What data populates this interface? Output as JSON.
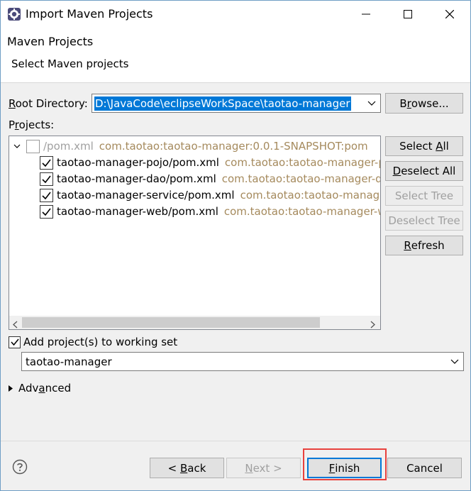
{
  "window": {
    "title": "Import Maven Projects",
    "minimize_icon": "minimize-icon",
    "maximize_icon": "maximize-icon",
    "close_icon": "close-icon"
  },
  "header": {
    "title": "Maven Projects",
    "subtitle": "Select Maven projects"
  },
  "root_directory": {
    "label_pre": "R",
    "label_rest": "oot Directory:",
    "value": "D:\\JavaCode\\eclipseWorkSpace\\taotao-manager",
    "browse_label_pre": "B",
    "browse_label_underline": "r",
    "browse_label_post": "owse..."
  },
  "projects": {
    "label_pre": "P",
    "label_underline": "r",
    "label_post": "ojects:",
    "tree": [
      {
        "name": "/pom.xml",
        "id": "com.taotao:taotao-manager:0.0.1-SNAPSHOT:pom",
        "checked": false,
        "level": 0
      },
      {
        "name": "taotao-manager-pojo/pom.xml",
        "id": "com.taotao:taotao-manager-p",
        "checked": true,
        "level": 1
      },
      {
        "name": "taotao-manager-dao/pom.xml",
        "id": "com.taotao:taotao-manager-da",
        "checked": true,
        "level": 1
      },
      {
        "name": "taotao-manager-service/pom.xml",
        "id": "com.taotao:taotao-manager",
        "checked": true,
        "level": 1
      },
      {
        "name": "taotao-manager-web/pom.xml",
        "id": "com.taotao:taotao-manager-w",
        "checked": true,
        "level": 1
      }
    ]
  },
  "side_buttons": {
    "select_all_pre": "Select ",
    "select_all_u": "A",
    "select_all_post": "ll",
    "deselect_all_u": "D",
    "deselect_all_post": "eselect All",
    "select_tree": "Select Tree",
    "deselect_tree": "Deselect Tree",
    "refresh_u": "R",
    "refresh_post": "efresh"
  },
  "working_set": {
    "checkbox_label": "Add project(s) to working set",
    "checked": true,
    "value": "taotao-manager"
  },
  "advanced": {
    "label_pre": "Adv",
    "label_underline": "a",
    "label_post": "nced"
  },
  "footer": {
    "help_icon": "help-icon",
    "back_pre": "< ",
    "back_u": "B",
    "back_post": "ack",
    "next_u": "N",
    "next_post": "ext >",
    "finish_u": "F",
    "finish_post": "inish",
    "cancel": "Cancel"
  },
  "colors": {
    "accent": "#0078d7",
    "artifact_id_text": "#a58a5d",
    "highlight_box": "#e8413d"
  }
}
